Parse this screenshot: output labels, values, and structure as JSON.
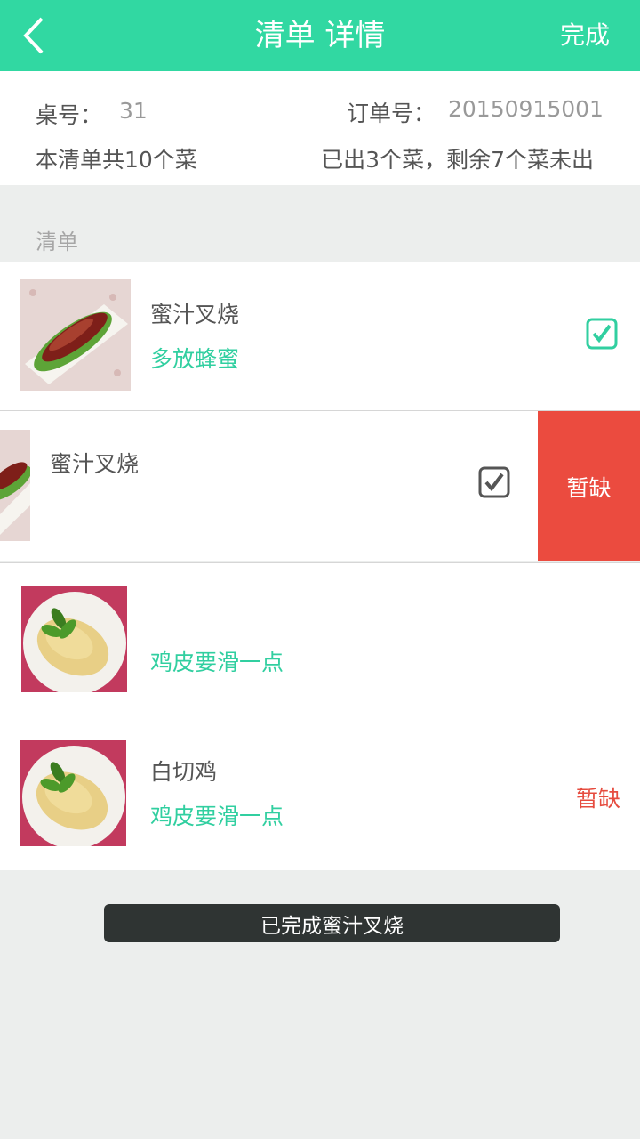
{
  "header": {
    "title": "清单 详情",
    "done_label": "完成",
    "back_icon": "chevron-left-icon"
  },
  "summary": {
    "table_label": "桌号：",
    "table_no": "31",
    "order_label": "订单号：",
    "order_no": "20150915001",
    "total_text": "本清单共10个菜",
    "progress_text": "已出3个菜，剩余7个菜未出"
  },
  "list": {
    "section_label": "清单",
    "items": [
      {
        "name": "蜜汁叉烧",
        "note": "多放蜂蜜",
        "checked": true,
        "check_style": "green"
      },
      {
        "name": "蜜汁叉烧",
        "note": "",
        "checked": true,
        "check_style": "gray",
        "swipe_action": "暂缺"
      },
      {
        "name": "",
        "note": "鸡皮要滑一点"
      },
      {
        "name": "白切鸡",
        "note": "鸡皮要滑一点",
        "status": "暂缺"
      }
    ]
  },
  "toast": {
    "message": "已完成蜜汁叉烧"
  },
  "colors": {
    "accent": "#31d8a2",
    "note_text": "#31cfa0",
    "danger": "#eb4b3f",
    "background": "#eceeed"
  }
}
